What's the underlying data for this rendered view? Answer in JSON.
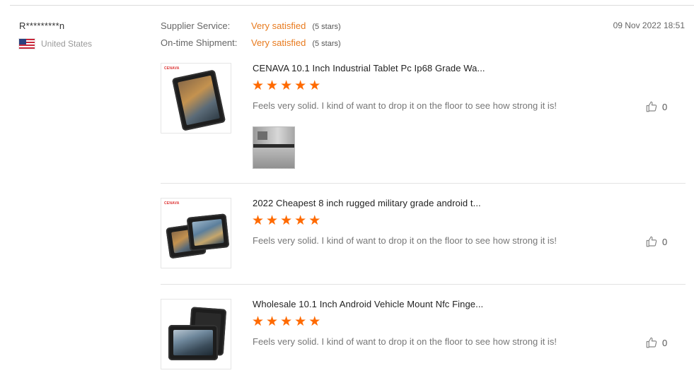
{
  "review": {
    "reviewer_name": "R*********n",
    "country": "United States",
    "date": "09 Nov 2022 18:51",
    "ratings": [
      {
        "label": "Supplier Service:",
        "value": "Very satisfied",
        "stars": "(5 stars)"
      },
      {
        "label": "On-time Shipment:",
        "value": "Very satisfied",
        "stars": "(5 stars)"
      }
    ]
  },
  "items": [
    {
      "title": "CENAVA 10.1 Inch Industrial Tablet Pc Ip68 Grade Wa...",
      "brand": "CENAVA",
      "rating": 5,
      "comment": "Feels very solid. I kind of want to drop it on the floor to see how strong it is!",
      "likes": "0",
      "has_photo": true
    },
    {
      "title": "2022 Cheapest 8 inch rugged military grade android t...",
      "brand": "CENAVA",
      "rating": 5,
      "comment": "Feels very solid. I kind of want to drop it on the floor to see how strong it is!",
      "likes": "0",
      "has_photo": false
    },
    {
      "title": "Wholesale 10.1 Inch Android Vehicle Mount Nfc Finge...",
      "brand": "",
      "rating": 5,
      "comment": "Feels very solid. I kind of want to drop it on the floor to see how strong it is!",
      "likes": "0",
      "has_photo": false
    }
  ],
  "colors": {
    "accent": "#e87a1d",
    "star": "#ff6a00",
    "divider": "#e3e3e3"
  },
  "icons": {
    "flag": "us-flag-icon",
    "like": "thumbs-up-icon",
    "star": "star-icon"
  }
}
